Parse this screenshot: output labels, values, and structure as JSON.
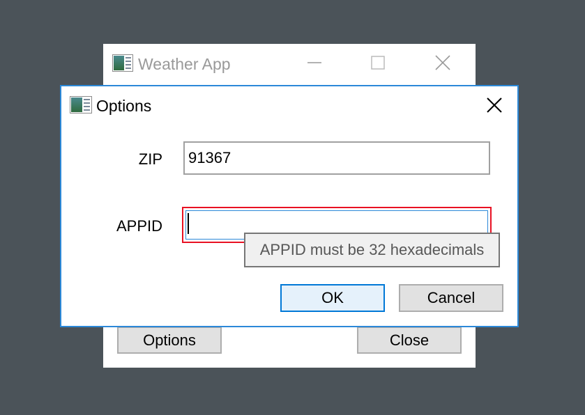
{
  "main_window": {
    "title": "Weather App",
    "icon": "app-window-icon",
    "controls": [
      "minimize-icon",
      "maximize-icon",
      "close-icon"
    ],
    "buttons": {
      "options": "Options",
      "close": "Close"
    }
  },
  "dialog": {
    "title": "Options",
    "icon": "app-window-icon",
    "fields": {
      "zip": {
        "label": "ZIP",
        "value": "91367"
      },
      "appid": {
        "label": "APPID",
        "value": ""
      }
    },
    "tooltip": "APPID must be 32 hexadecimals",
    "buttons": {
      "ok": "OK",
      "cancel": "Cancel"
    }
  },
  "colors": {
    "desktop": "#4b5359",
    "dialog_border": "#2b88d8",
    "error_border": "#e81123",
    "default_button_border": "#0078d7",
    "button_face": "#e1e1e1"
  }
}
